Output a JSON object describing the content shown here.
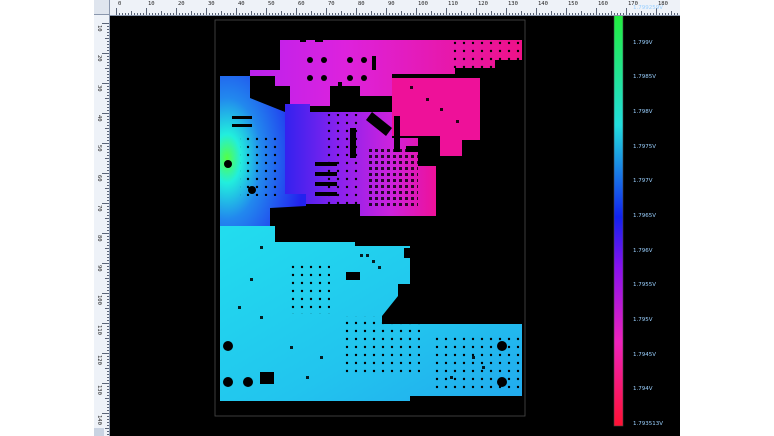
{
  "ruler": {
    "top_labels": [
      "0",
      "10",
      "20",
      "30",
      "40",
      "50",
      "60",
      "70",
      "80",
      "90",
      "100",
      "110",
      "120",
      "130",
      "140",
      "150",
      "160",
      "170",
      "180"
    ],
    "left_labels": [
      "10",
      "20",
      "30",
      "40",
      "50",
      "60",
      "70",
      "80",
      "90",
      "100",
      "110",
      "120",
      "130",
      "140"
    ]
  },
  "colorbar": {
    "labels": [
      "1.799259V",
      "1.799V",
      "1.7985V",
      "1.798V",
      "1.7975V",
      "1.797V",
      "1.7965V",
      "1.796V",
      "1.7955V",
      "1.795V",
      "1.7945V",
      "1.794V",
      "1.793513V"
    ],
    "colors": {
      "max": "#22ee33",
      "upper": "#22dddd",
      "mid_blue": "#1122ee",
      "mid_violet": "#8811ee",
      "magenta": "#ee22bb",
      "min": "#ff1133"
    }
  },
  "plot": {
    "background": "#000000",
    "board_colors": {
      "green": "#44ee44",
      "cyan": "#22ddee",
      "sky": "#22bbee",
      "blue": "#2244ee",
      "violet": "#9922ee",
      "magenta": "#dd22dd",
      "pink": "#ee1199"
    }
  }
}
